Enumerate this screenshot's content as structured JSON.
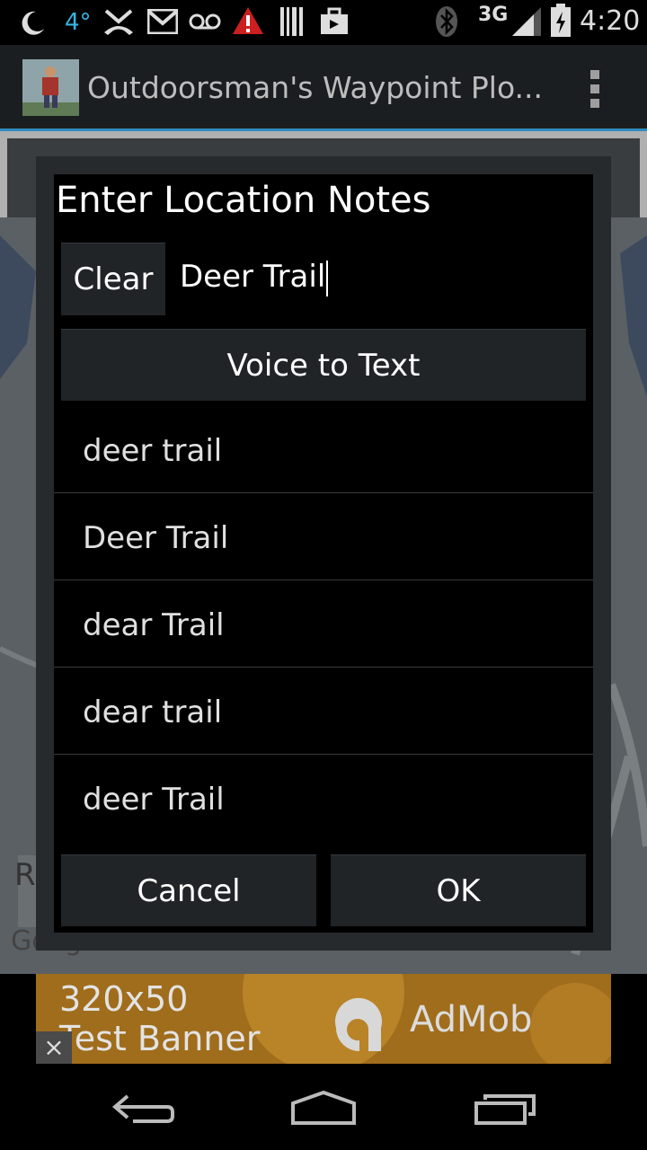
{
  "status_bar": {
    "temperature": "4°",
    "network": "3G",
    "time": "4:20",
    "icons": [
      "moon-icon",
      "missed-call-icon",
      "gmail-icon",
      "voicemail-icon",
      "warning-icon",
      "barcode-icon",
      "briefcase-icon",
      "bluetooth-icon",
      "signal-icon",
      "battery-icon"
    ]
  },
  "action_bar": {
    "title": "Outdoorsman's Waypoint Plo...",
    "accent": "#2f8cbc"
  },
  "map": {
    "partial_letter": "R",
    "attribution": "Google"
  },
  "dialog": {
    "title": "Enter Location Notes",
    "clear_label": "Clear",
    "notes_value": "Deer Trail",
    "voice_label": "Voice to Text",
    "suggestions": [
      "deer trail",
      "Deer Trail",
      "dear Trail",
      "dear trail",
      "deer Trail"
    ],
    "cancel_label": "Cancel",
    "ok_label": "OK"
  },
  "ad": {
    "line1": "320x50",
    "line2": "Test Banner",
    "brand": "AdMob",
    "close_symbol": "×"
  }
}
